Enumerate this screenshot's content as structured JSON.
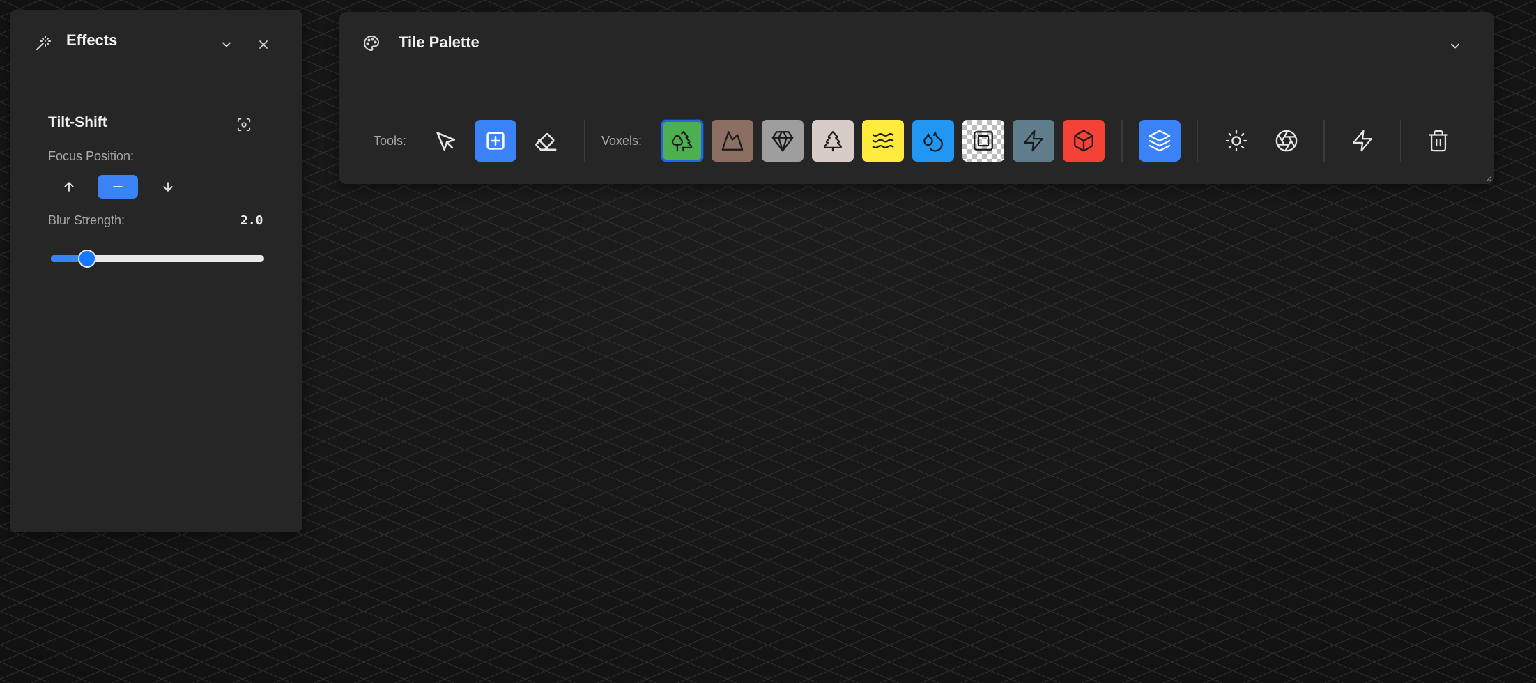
{
  "effects_panel": {
    "title": "Effects",
    "icon": "magic-wand-icon",
    "tilt_shift": {
      "title": "Tilt-Shift",
      "focus_position_label": "Focus Position:",
      "focus_options": [
        "up",
        "center",
        "down"
      ],
      "focus_selected": "center",
      "blur_strength_label": "Blur Strength:",
      "blur_strength_value": "2.0",
      "blur_strength_fraction": 0.17
    }
  },
  "tile_palette": {
    "title": "Tile Palette",
    "icon": "palette-icon",
    "tools_label": "Tools:",
    "voxels_label": "Voxels:",
    "tools": [
      {
        "name": "select",
        "icon": "cursor-icon",
        "active": false
      },
      {
        "name": "add",
        "icon": "square-plus-icon",
        "active": true
      },
      {
        "name": "erase",
        "icon": "eraser-icon",
        "active": false
      }
    ],
    "voxels": [
      {
        "name": "grass",
        "icon": "trees-icon",
        "color": "#4caf50",
        "selected": true
      },
      {
        "name": "dirt",
        "icon": "mountain-icon",
        "color": "#8d6e63"
      },
      {
        "name": "stone",
        "icon": "gem-icon",
        "color": "#9e9e9e"
      },
      {
        "name": "snow",
        "icon": "pine-tree-icon",
        "color": "#d7ccc8"
      },
      {
        "name": "sand",
        "icon": "waves-icon",
        "color": "#ffeb3b"
      },
      {
        "name": "water",
        "icon": "droplets-icon",
        "color": "#2196f3"
      },
      {
        "name": "glass",
        "icon": "frame-icon",
        "color": "#ffffff"
      },
      {
        "name": "metal",
        "icon": "zap-icon",
        "color": "#607d8b"
      },
      {
        "name": "brick",
        "icon": "box-icon",
        "color": "#f44336"
      }
    ],
    "accent_color": "#3b82f6"
  }
}
